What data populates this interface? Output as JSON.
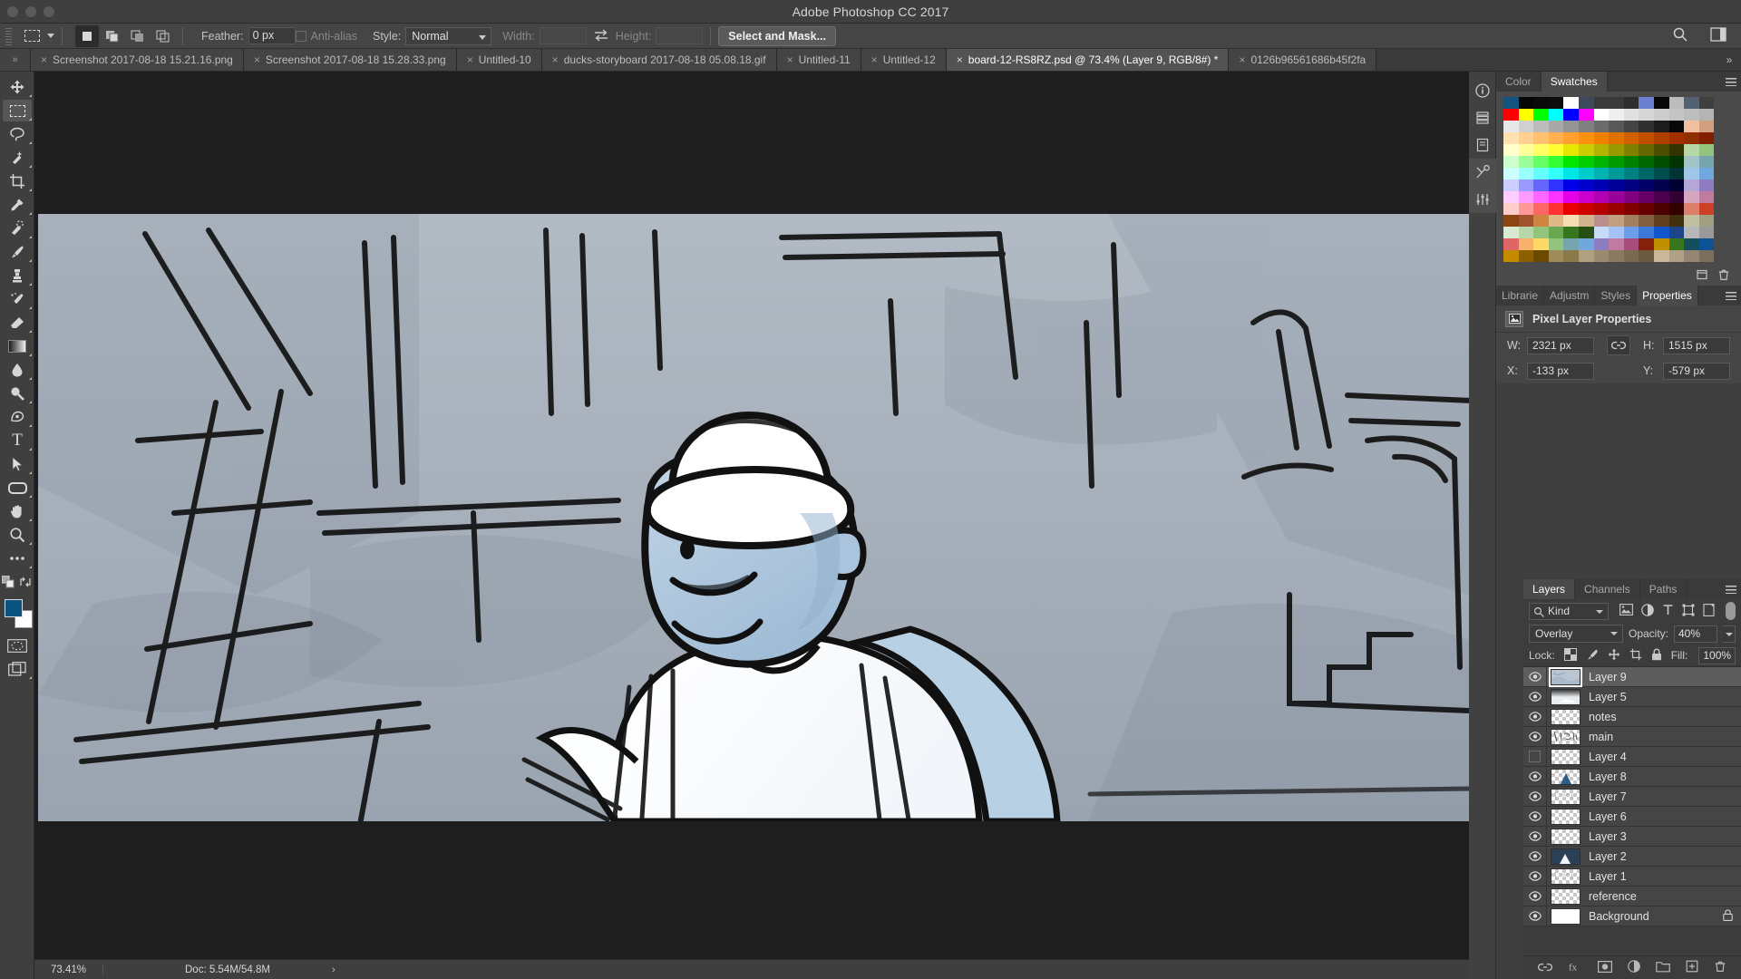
{
  "app": {
    "title": "Adobe Photoshop CC 2017"
  },
  "options_bar": {
    "tool_icon": "rectangular-marquee-icon",
    "bool_modes": [
      "new-selection",
      "add-to-selection",
      "subtract-from-selection",
      "intersect-selection"
    ],
    "feather_label": "Feather:",
    "feather_value": "0 px",
    "antialias_label": "Anti-alias",
    "style_label": "Style:",
    "style_value": "Normal",
    "width_label": "Width:",
    "width_value": "",
    "height_label": "Height:",
    "height_value": "",
    "select_and_mask_label": "Select and Mask..."
  },
  "tabs": {
    "collapse_glyph": "»",
    "overflow_glyph": "»",
    "items": [
      {
        "label": "Screenshot 2017-08-18 15.21.16.png",
        "active": false
      },
      {
        "label": "Screenshot 2017-08-18 15.28.33.png",
        "active": false
      },
      {
        "label": "Untitled-10",
        "active": false
      },
      {
        "label": "ducks-storyboard 2017-08-18 05.08.18.gif",
        "active": false
      },
      {
        "label": "Untitled-11",
        "active": false
      },
      {
        "label": "Untitled-12",
        "active": false
      },
      {
        "label": "board-12-RS8RZ.psd @ 73.4% (Layer 9, RGB/8#) *",
        "active": true
      },
      {
        "label": "0126b96561686b45f2fa",
        "active": false
      }
    ]
  },
  "toolbar": {
    "tools": [
      {
        "name": "move-tool",
        "active": false
      },
      {
        "name": "rectangular-marquee-tool",
        "active": true
      },
      {
        "name": "lasso-tool",
        "active": false
      },
      {
        "name": "quick-selection-tool",
        "active": false
      },
      {
        "name": "crop-tool",
        "active": false
      },
      {
        "name": "eyedropper-tool",
        "active": false
      },
      {
        "name": "spot-healing-brush-tool",
        "active": false
      },
      {
        "name": "brush-tool",
        "active": false
      },
      {
        "name": "clone-stamp-tool",
        "active": false
      },
      {
        "name": "history-brush-tool",
        "active": false
      },
      {
        "name": "eraser-tool",
        "active": false
      },
      {
        "name": "gradient-tool",
        "active": false
      },
      {
        "name": "blur-tool",
        "active": false
      },
      {
        "name": "dodge-tool",
        "active": false
      },
      {
        "name": "pen-tool",
        "active": false
      },
      {
        "name": "type-tool",
        "active": false
      },
      {
        "name": "path-selection-tool",
        "active": false
      },
      {
        "name": "rectangle-tool",
        "active": false
      },
      {
        "name": "hand-tool",
        "active": false
      },
      {
        "name": "zoom-tool",
        "active": false
      },
      {
        "name": "edit-toolbar-tool",
        "active": false
      }
    ],
    "foreground_color": "#0b5480",
    "background_color": "#ffffff"
  },
  "status_bar": {
    "zoom": "73.41%",
    "doc_info": "Doc: 5.54M/54.8M",
    "arrow_glyph": "›"
  },
  "icon_dock": {
    "items": [
      "info-icon",
      "history-icon",
      "notes-icon",
      "actions-icon",
      "adjustments-icon"
    ]
  },
  "color_panel": {
    "tabs": [
      {
        "label": "Color",
        "active": false
      },
      {
        "label": "Swatches",
        "active": true
      }
    ],
    "swatch_rows": [
      [
        "#12547e",
        "#060606",
        "#0a0a0a",
        "#0d0d0d",
        "#ffffff",
        "#3c4a5c",
        "#3a3a3a",
        "#3a3a3a",
        "#2e2e2e",
        "#6a7fcf",
        "#080808",
        "#bcbcbc",
        "#536273",
        "#3f3f3f"
      ],
      [
        "#ff0000",
        "#ffff00",
        "#00ff00",
        "#00ffff",
        "#0000ff",
        "#ff00ff",
        "#ffffff",
        "#efefef",
        "#e0e0e0",
        "#d6d6d6",
        "#cccccc",
        "#c4c4c4",
        "#bdbdbd",
        "#b4b4b4"
      ],
      [
        "#e8e8e8",
        "#d0d0d0",
        "#bcbcbc",
        "#a8a8a8",
        "#949494",
        "#808080",
        "#6c6c6c",
        "#585858",
        "#444444",
        "#303030",
        "#1c1c1c",
        "#080808",
        "#f0c0a0",
        "#d0a080"
      ],
      [
        "#ffe0b0",
        "#ffd090",
        "#ffc070",
        "#ffb050",
        "#ffa030",
        "#ff9010",
        "#f08000",
        "#e07000",
        "#d06000",
        "#c05000",
        "#b04000",
        "#a03000",
        "#903000",
        "#802000"
      ],
      [
        "#ffffcc",
        "#ffff99",
        "#ffff66",
        "#ffff33",
        "#e6e600",
        "#cccc00",
        "#b3b300",
        "#999900",
        "#808000",
        "#666600",
        "#4d4d00",
        "#333300",
        "#b6d7a8",
        "#93c47d"
      ],
      [
        "#ccffcc",
        "#99ff99",
        "#66ff66",
        "#33ff33",
        "#00e600",
        "#00cc00",
        "#00b300",
        "#009900",
        "#008000",
        "#006600",
        "#004d00",
        "#003300",
        "#a2c4c9",
        "#76a5af"
      ],
      [
        "#ccffff",
        "#99ffff",
        "#66ffff",
        "#33ffff",
        "#00e6e6",
        "#00cccc",
        "#00b3b3",
        "#009999",
        "#008080",
        "#006666",
        "#004d4d",
        "#003333",
        "#9fc5e8",
        "#6fa8dc"
      ],
      [
        "#ccccff",
        "#9999ff",
        "#6666ff",
        "#3333ff",
        "#0000e6",
        "#0000cc",
        "#0000b3",
        "#000099",
        "#000080",
        "#000066",
        "#00004d",
        "#000033",
        "#b4a7d6",
        "#8e7cc3"
      ],
      [
        "#ffccff",
        "#ff99ff",
        "#ff66ff",
        "#ff33ff",
        "#e600e6",
        "#cc00cc",
        "#b300b3",
        "#990099",
        "#800080",
        "#660066",
        "#4d004d",
        "#330033",
        "#d5a6bd",
        "#c27ba0"
      ],
      [
        "#ffcccc",
        "#ff9999",
        "#ff6666",
        "#ff3333",
        "#e60000",
        "#cc0000",
        "#b30000",
        "#990000",
        "#800000",
        "#660000",
        "#4d0000",
        "#330000",
        "#dd7e6b",
        "#cc4125"
      ],
      [
        "#8b4513",
        "#a0522d",
        "#cd853f",
        "#deb887",
        "#f5deb3",
        "#d2b48c",
        "#bc8f8f",
        "#c0a080",
        "#a08060",
        "#806040",
        "#604020",
        "#403010",
        "#c0c0a0",
        "#a0a080"
      ],
      [
        "#d9ead3",
        "#b6d7a8",
        "#93c47d",
        "#6aa84f",
        "#38761d",
        "#274e13",
        "#c9daf8",
        "#a4c2f4",
        "#6d9eeb",
        "#3c78d8",
        "#1155cc",
        "#1c4587",
        "#b7b7b7",
        "#999999"
      ],
      [
        "#e06666",
        "#f6b26b",
        "#ffd966",
        "#93c47d",
        "#76a5af",
        "#6fa8dc",
        "#8e7cc3",
        "#c27ba0",
        "#a64d79",
        "#85200c",
        "#bf9000",
        "#38761d",
        "#134f5c",
        "#0b5394"
      ],
      [
        "#c68a00",
        "#8a6000",
        "#6b4a00",
        "#a08a5a",
        "#8a7a4a",
        "#b0a080",
        "#9a8a70",
        "#8a7a60",
        "#7a6a50",
        "#6a5a40",
        "#cbb89a",
        "#b0a088",
        "#948572",
        "#7c6f5e"
      ]
    ],
    "footer_icons": [
      "new-swatch-icon",
      "delete-swatch-icon"
    ]
  },
  "properties_panel": {
    "tabs": [
      {
        "label": "Librarie",
        "active": false
      },
      {
        "label": "Adjustm",
        "active": false
      },
      {
        "label": "Styles",
        "active": false
      },
      {
        "label": "Properties",
        "active": true
      }
    ],
    "heading": "Pixel Layer Properties",
    "fields": {
      "w_label": "W:",
      "w_value": "2321 px",
      "h_label": "H:",
      "h_value": "1515 px",
      "x_label": "X:",
      "x_value": "-133 px",
      "y_label": "Y:",
      "y_value": "-579 px",
      "link_icon": "link-icon"
    }
  },
  "layers_panel": {
    "tabs": [
      {
        "label": "Layers",
        "active": true
      },
      {
        "label": "Channels",
        "active": false
      },
      {
        "label": "Paths",
        "active": false
      }
    ],
    "filter": {
      "kind_label": "Kind",
      "icons": [
        "pixel-filter-icon",
        "adjustment-filter-icon",
        "type-filter-icon",
        "shape-filter-icon",
        "smart-object-filter-icon"
      ],
      "toggle_on": true
    },
    "blend_mode": "Overlay",
    "opacity_label": "Opacity:",
    "opacity_value": "40%",
    "lock_label": "Lock:",
    "lock_icons": [
      "lock-transparent-pixels-icon",
      "lock-image-pixels-icon",
      "lock-position-icon",
      "lock-artboard-icon",
      "lock-all-icon"
    ],
    "fill_label": "Fill:",
    "fill_value": "100%",
    "layers": [
      {
        "name": "Layer 9",
        "visible": true,
        "selected": true,
        "thumb": "texture",
        "locked": false
      },
      {
        "name": "Layer 5",
        "visible": true,
        "selected": false,
        "thumb": "gradient",
        "locked": false
      },
      {
        "name": "notes",
        "visible": true,
        "selected": false,
        "thumb": "empty",
        "locked": false
      },
      {
        "name": "main",
        "visible": true,
        "selected": false,
        "thumb": "sketch",
        "locked": false
      },
      {
        "name": "Layer 4",
        "visible": false,
        "selected": false,
        "thumb": "empty",
        "locked": false
      },
      {
        "name": "Layer 8",
        "visible": true,
        "selected": false,
        "thumb": "blueshape",
        "locked": false
      },
      {
        "name": "Layer 7",
        "visible": true,
        "selected": false,
        "thumb": "faint",
        "locked": false
      },
      {
        "name": "Layer 6",
        "visible": true,
        "selected": false,
        "thumb": "empty",
        "locked": false
      },
      {
        "name": "Layer 3",
        "visible": true,
        "selected": false,
        "thumb": "empty",
        "locked": false
      },
      {
        "name": "Layer 2",
        "visible": true,
        "selected": false,
        "thumb": "darkblue",
        "locked": false
      },
      {
        "name": "Layer 1",
        "visible": true,
        "selected": false,
        "thumb": "faint",
        "locked": false
      },
      {
        "name": "reference",
        "visible": true,
        "selected": false,
        "thumb": "empty",
        "locked": false
      },
      {
        "name": "Background",
        "visible": true,
        "selected": false,
        "thumb": "white",
        "locked": true
      }
    ],
    "footer_icons": [
      "link-layers-icon",
      "layer-style-icon",
      "layer-mask-icon",
      "adjustment-layer-icon",
      "new-group-icon",
      "new-layer-icon",
      "delete-layer-icon"
    ]
  },
  "canvas": {
    "description": "storyboard sketch of a character in a hard hat on a boat",
    "background_color": "#a6aeb8"
  }
}
